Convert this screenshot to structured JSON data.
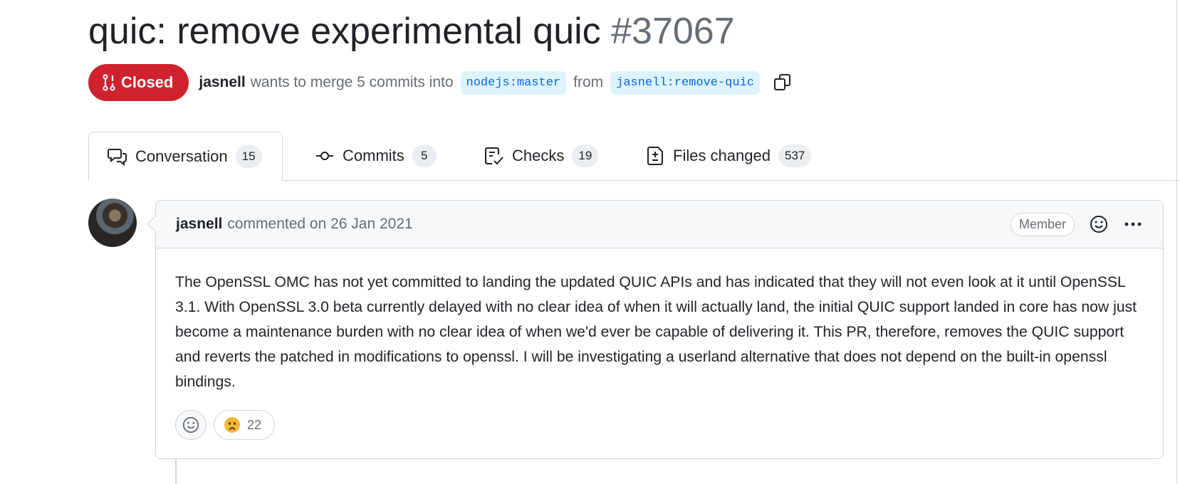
{
  "pr": {
    "title": "quic: remove experimental quic",
    "number": "#37067",
    "state": "Closed",
    "author": "jasnell",
    "merge_text": "wants to merge 5 commits into",
    "base_branch": "nodejs:master",
    "from_text": "from",
    "head_branch": "jasnell:remove-quic"
  },
  "tabs": [
    {
      "label": "Conversation",
      "count": "15",
      "icon": "comment-discussion-icon"
    },
    {
      "label": "Commits",
      "count": "5",
      "icon": "commit-icon"
    },
    {
      "label": "Checks",
      "count": "19",
      "icon": "checklist-icon"
    },
    {
      "label": "Files changed",
      "count": "537",
      "icon": "file-diff-icon"
    }
  ],
  "comment": {
    "author": "jasnell",
    "action": "commented on 26 Jan 2021",
    "role": "Member",
    "body": "The OpenSSL OMC has not yet committed to landing the updated QUIC APIs and has indicated that they will not even look at it until OpenSSL 3.1. With OpenSSL 3.0 beta currently delayed with no clear idea of when it will actually land, the initial QUIC support landed in core has now just become a maintenance burden with no clear idea of when we'd ever be capable of delivering it. This PR, therefore, removes the QUIC support and reverts the patched in modifications to openssl. I will be investigating a userland alternative that does not depend on the built-in openssl bindings.",
    "reaction": {
      "emoji": "confused-face",
      "count": "22"
    }
  },
  "colors": {
    "closed": "#cf222e",
    "branch_bg": "#ddf4ff",
    "branch_fg": "#0969da"
  }
}
